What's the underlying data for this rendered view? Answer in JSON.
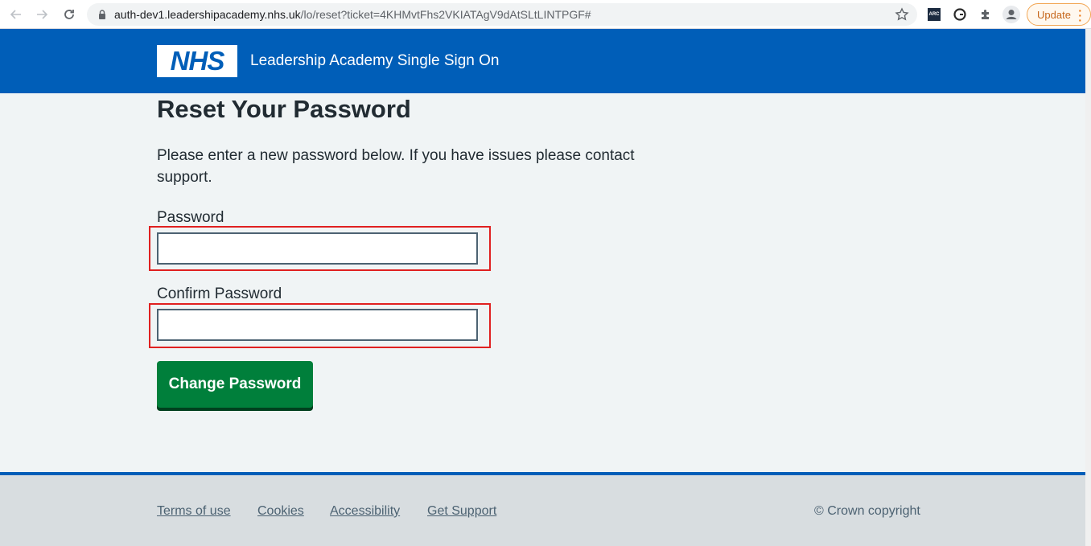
{
  "browser": {
    "url_host": "auth-dev1.leadershipacademy.nhs.uk",
    "url_path": "/lo/reset?ticket=4KHMvtFhs2VKIATAgV9dAtSLtLINTPGF#",
    "update_label": "Update",
    "arc_label": "ARC"
  },
  "header": {
    "logo_text": "NHS",
    "service_name": "Leadership Academy Single Sign On"
  },
  "main": {
    "title": "Reset Your Password",
    "lede": "Please enter a new password below. If you have issues please contact support.",
    "password_label": "Password",
    "password_value": "",
    "confirm_label": "Confirm Password",
    "confirm_value": "",
    "submit_label": "Change Password"
  },
  "footer": {
    "links": [
      "Terms of use",
      "Cookies",
      "Accessibility",
      "Get Support"
    ],
    "copyright": "© Crown copyright"
  },
  "colors": {
    "nhs_blue": "#005eb8",
    "button_green": "#007f3b",
    "highlight_red": "#e02020"
  }
}
